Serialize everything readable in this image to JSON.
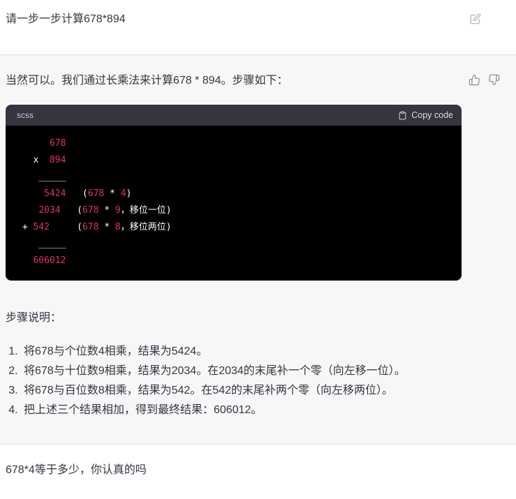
{
  "colors": {
    "assistant_bg": "#f7f7f8",
    "code_bg": "#000000",
    "code_header_bg": "#343541",
    "code_number_accent": "#df3079",
    "code_plain": "#ffffff",
    "body_text": "#343541",
    "icon_gray": "#8e8ea0"
  },
  "user_message_1": {
    "text": "请一步一步计算678*894",
    "edit_icon": "edit-icon"
  },
  "assistant_message": {
    "intro": "当然可以。我们通过长乘法来计算678 * 894。步骤如下：",
    "feedback": {
      "thumbs_up_icon": "thumbs-up-icon",
      "thumbs_down_icon": "thumbs-down-icon"
    },
    "code": {
      "language": "scss",
      "copy_label": "Copy code",
      "copy_icon": "clipboard-icon",
      "lines": [
        [
          [
            "p",
            "      "
          ],
          [
            "n",
            "678"
          ]
        ],
        [
          [
            "p",
            "   x  "
          ],
          [
            "n",
            "894"
          ]
        ],
        [
          [
            "p",
            "    _____"
          ]
        ],
        [
          [
            "p",
            "     "
          ],
          [
            "n",
            "5424"
          ],
          [
            "p",
            "   ("
          ],
          [
            "n",
            "678"
          ],
          [
            "p",
            " * "
          ],
          [
            "n",
            "4"
          ],
          [
            "p",
            ")"
          ]
        ],
        [
          [
            "p",
            "    "
          ],
          [
            "n",
            "2034"
          ],
          [
            "p",
            "   ("
          ],
          [
            "n",
            "678"
          ],
          [
            "p",
            " * "
          ],
          [
            "n",
            "9"
          ],
          [
            "p",
            "，移位一位)"
          ]
        ],
        [
          [
            "p",
            " + "
          ],
          [
            "n",
            "542"
          ],
          [
            "p",
            "     ("
          ],
          [
            "n",
            "678"
          ],
          [
            "p",
            " * "
          ],
          [
            "n",
            "8"
          ],
          [
            "p",
            "，移位两位)"
          ]
        ],
        [
          [
            "p",
            "    _____"
          ]
        ],
        [
          [
            "p",
            "   "
          ],
          [
            "n",
            "606012"
          ]
        ]
      ]
    },
    "steps_title": "步骤说明：",
    "steps": [
      "将678与个位数4相乘，结果为5424。",
      "将678与十位数9相乘，结果为2034。在2034的末尾补一个零（向左移一位）。",
      "将678与百位数8相乘，结果为542。在542的末尾补两个零（向左移两位）。",
      "把上述三个结果相加，得到最终结果：606012。"
    ]
  },
  "user_message_2": {
    "text": "678*4等于多少，你认真的吗"
  }
}
